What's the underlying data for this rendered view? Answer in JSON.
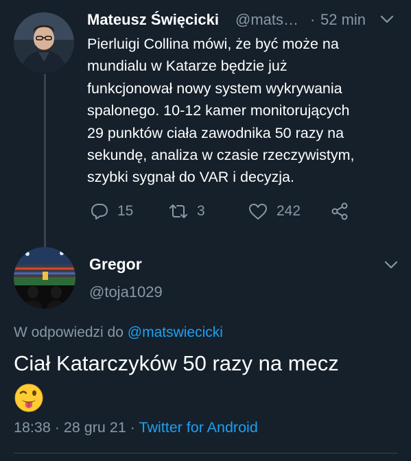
{
  "tweet1": {
    "author_name": "Mateusz Święcicki",
    "author_handle": "@mats…",
    "separator": "·",
    "time": "52 min",
    "lines": [
      "Pierluigi Collina mówi, że być może na",
      "mundialu w Katarze będzie już",
      "funkcjonował nowy system wykrywania",
      "spalonego. 10-12 kamer monitorujących",
      "29 punktów ciała zawodnika 50 razy na",
      "sekundę, analiza w czasie rzeczywistym,",
      "szybki sygnał do VAR i decyzja."
    ],
    "replies": "15",
    "retweets": "3",
    "likes": "242"
  },
  "tweet2": {
    "author_name": "Gregor",
    "author_handle": "@toja1029",
    "reply_prefix": "W odpowiedzi do ",
    "reply_mention": "@matswiecicki",
    "text": "Ciał Katarczyków 50 razy na mecz",
    "emoji": "winking-face-with-tongue",
    "time": "18:38",
    "sep1": " · ",
    "date": "28 gru 21",
    "sep2": " · ",
    "source": "Twitter for Android"
  },
  "colors": {
    "background": "#15202b",
    "secondary_text": "#8899a6",
    "link": "#1da1f2",
    "divider": "#38444d"
  }
}
